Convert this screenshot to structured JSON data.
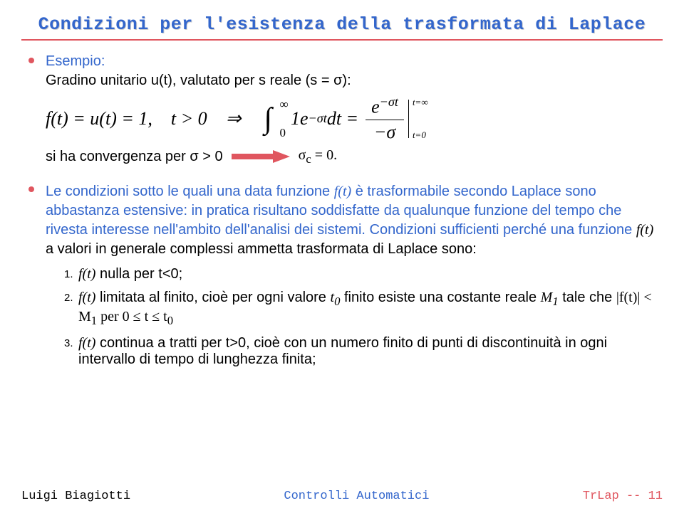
{
  "title": "Condizioni per l'esistenza della trasformata di Laplace",
  "b1": {
    "esempio": "Esempio:",
    "line1": "Gradino unitario u(t), valutato per s reale (s = σ):",
    "eq_left": "f(t) = u(t) = 1, t > 0 ⇒",
    "int_one": "1",
    "int_e": "e",
    "int_expo": "−σt",
    "int_dt": "dt =",
    "frac_top_e": "e",
    "frac_top_expo": "−σt",
    "frac_bot": "−σ",
    "eval_top": "t=∞",
    "eval_bot": "t=0",
    "conv": "si ha convergenza per σ > 0",
    "sigc": "σ",
    "sigc_sub": "c",
    "sigc_eq": " = 0."
  },
  "b2": {
    "p_a": "Le condizioni sotto le quali una data funzione ",
    "ft1": "f(t)",
    "p_b": " è trasformabile secondo Laplace sono abbastanza estensive: in pratica risultano soddisfatte da qualunque funzione del tempo che rivesta interesse nell'ambito dell'analisi dei sistemi. Condizioni sufficienti perché una funzione ",
    "ft2": "f(t)",
    "p_c": " a valori in generale complessi ammetta trasformata di Laplace sono:",
    "s1_ft": "f(t)",
    "s1_txt": " nulla per t<0;",
    "s2_ft": "f(t)",
    "s2_a": " limitata al finito, cioè per ogni valore ",
    "s2_t0": "t",
    "s2_t0sub": "0",
    "s2_b": " finito esiste una costante reale ",
    "s2_M1": "M",
    "s2_M1sub": "1",
    "s2_c": " tale che ",
    "s2_ineq_a": "|f(t)| < M",
    "s2_ineq_Msub": "1",
    "s2_ineq_b": " per 0 ≤ t ≤ t",
    "s2_ineq_tsub": "0",
    "s3_ft": "f(t)",
    "s3_txt": " continua a tratti per t>0, cioè con un numero finito di punti di discontinuità in ogni intervallo di tempo di lunghezza finita;",
    "n1": "1.",
    "n2": "2.",
    "n3": "3."
  },
  "footer": {
    "left": "Luigi Biagiotti",
    "center": "Controlli Automatici",
    "right": "TrLap -- 11"
  }
}
